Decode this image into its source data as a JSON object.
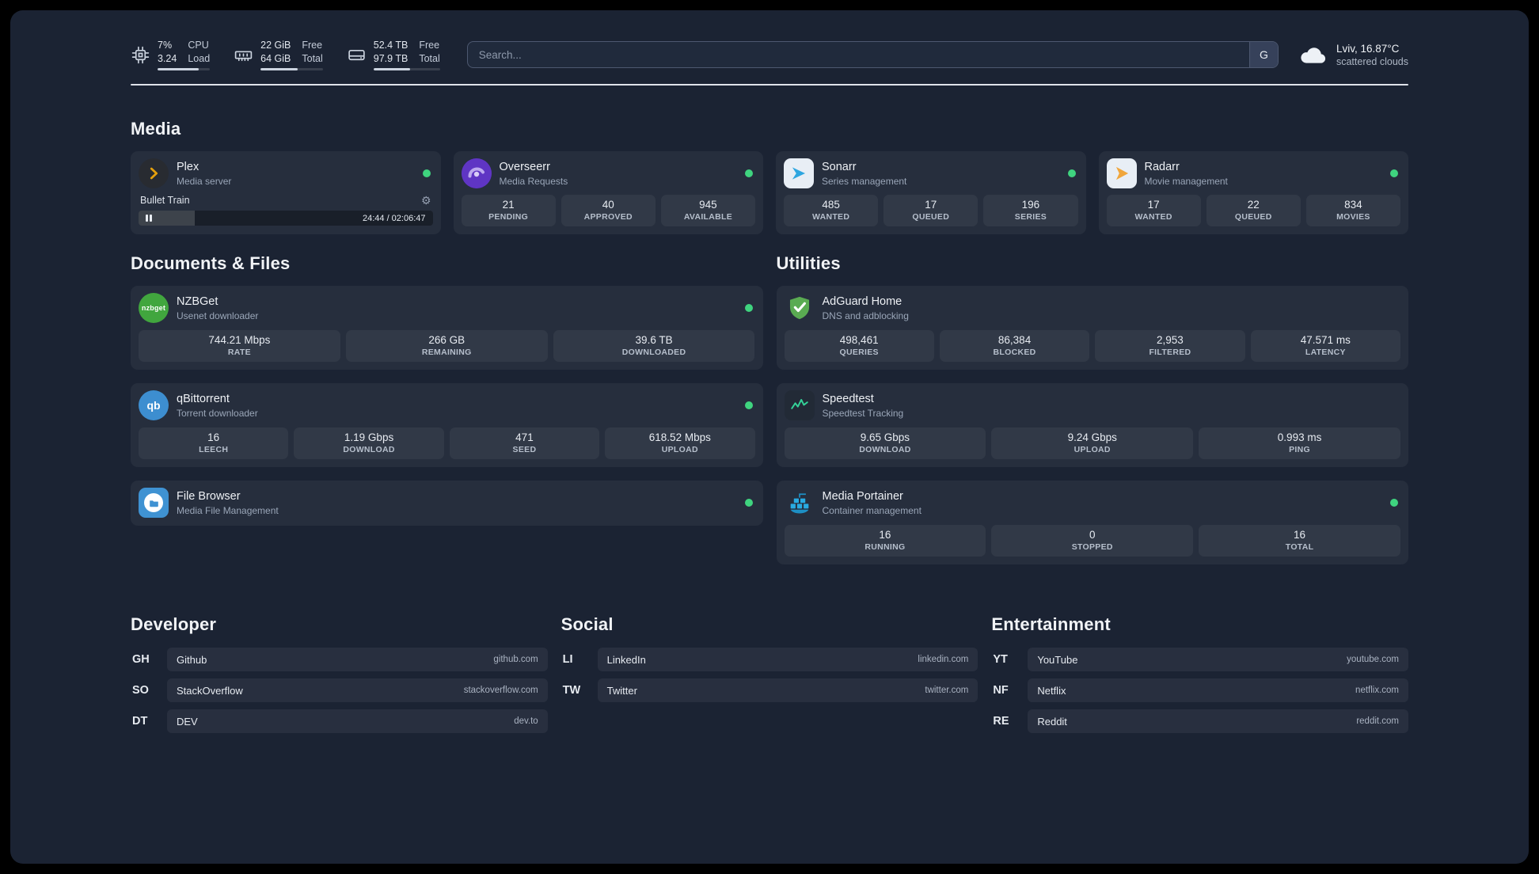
{
  "topbar": {
    "cpu": {
      "value1": "7%",
      "value2": "3.24",
      "label1": "CPU",
      "label2": "Load"
    },
    "memory": {
      "value1": "22 GiB",
      "value2": "64 GiB",
      "label1": "Free",
      "label2": "Total"
    },
    "disk": {
      "value1": "52.4 TB",
      "value2": "97.9 TB",
      "label1": "Free",
      "label2": "Total"
    },
    "search": {
      "placeholder": "Search...",
      "provider_label": "G"
    },
    "weather": {
      "location": "Lviv, 16.87°C",
      "condition": "scattered clouds"
    }
  },
  "sections": {
    "media": "Media",
    "documents": "Documents & Files",
    "utilities": "Utilities",
    "developer": "Developer",
    "social": "Social",
    "entertainment": "Entertainment"
  },
  "services": {
    "plex": {
      "title": "Plex",
      "subtitle": "Media server",
      "now_playing": "Bullet Train",
      "time": "24:44 / 02:06:47"
    },
    "overseerr": {
      "title": "Overseerr",
      "subtitle": "Media Requests",
      "stats": [
        {
          "value": "21",
          "label": "PENDING"
        },
        {
          "value": "40",
          "label": "APPROVED"
        },
        {
          "value": "945",
          "label": "AVAILABLE"
        }
      ]
    },
    "sonarr": {
      "title": "Sonarr",
      "subtitle": "Series management",
      "stats": [
        {
          "value": "485",
          "label": "WANTED"
        },
        {
          "value": "17",
          "label": "QUEUED"
        },
        {
          "value": "196",
          "label": "SERIES"
        }
      ]
    },
    "radarr": {
      "title": "Radarr",
      "subtitle": "Movie management",
      "stats": [
        {
          "value": "17",
          "label": "WANTED"
        },
        {
          "value": "22",
          "label": "QUEUED"
        },
        {
          "value": "834",
          "label": "MOVIES"
        }
      ]
    },
    "nzbget": {
      "title": "NZBGet",
      "subtitle": "Usenet downloader",
      "logo_text": "nzbget",
      "stats": [
        {
          "value": "744.21 Mbps",
          "label": "RATE"
        },
        {
          "value": "266 GB",
          "label": "REMAINING"
        },
        {
          "value": "39.6 TB",
          "label": "DOWNLOADED"
        }
      ]
    },
    "qbittorrent": {
      "title": "qBittorrent",
      "subtitle": "Torrent downloader",
      "logo_text": "qb",
      "stats": [
        {
          "value": "16",
          "label": "LEECH"
        },
        {
          "value": "1.19 Gbps",
          "label": "DOWNLOAD"
        },
        {
          "value": "471",
          "label": "SEED"
        },
        {
          "value": "618.52 Mbps",
          "label": "UPLOAD"
        }
      ]
    },
    "filebrowser": {
      "title": "File Browser",
      "subtitle": "Media File Management"
    },
    "adguard": {
      "title": "AdGuard Home",
      "subtitle": "DNS and adblocking",
      "stats": [
        {
          "value": "498,461",
          "label": "QUERIES"
        },
        {
          "value": "86,384",
          "label": "BLOCKED"
        },
        {
          "value": "2,953",
          "label": "FILTERED"
        },
        {
          "value": "47.571 ms",
          "label": "LATENCY"
        }
      ]
    },
    "speedtest": {
      "title": "Speedtest",
      "subtitle": "Speedtest Tracking",
      "stats": [
        {
          "value": "9.65 Gbps",
          "label": "DOWNLOAD"
        },
        {
          "value": "9.24 Gbps",
          "label": "UPLOAD"
        },
        {
          "value": "0.993 ms",
          "label": "PING"
        }
      ]
    },
    "portainer": {
      "title": "Media Portainer",
      "subtitle": "Container management",
      "stats": [
        {
          "value": "16",
          "label": "RUNNING"
        },
        {
          "value": "0",
          "label": "STOPPED"
        },
        {
          "value": "16",
          "label": "TOTAL"
        }
      ]
    }
  },
  "bookmarks": {
    "developer": [
      {
        "abbr": "GH",
        "name": "Github",
        "url": "github.com"
      },
      {
        "abbr": "SO",
        "name": "StackOverflow",
        "url": "stackoverflow.com"
      },
      {
        "abbr": "DT",
        "name": "DEV",
        "url": "dev.to"
      }
    ],
    "social": [
      {
        "abbr": "LI",
        "name": "LinkedIn",
        "url": "linkedin.com"
      },
      {
        "abbr": "TW",
        "name": "Twitter",
        "url": "twitter.com"
      }
    ],
    "entertainment": [
      {
        "abbr": "YT",
        "name": "YouTube",
        "url": "youtube.com"
      },
      {
        "abbr": "NF",
        "name": "Netflix",
        "url": "netflix.com"
      },
      {
        "abbr": "RE",
        "name": "Reddit",
        "url": "reddit.com"
      }
    ]
  },
  "colors": {
    "status_online": "#3fd47f",
    "accent_plex": "#e5a00d",
    "accent_overseerr": "#5f35c4",
    "accent_sonarr": "#2ea6e0",
    "accent_radarr": "#f0a63c",
    "accent_nzbget": "#41a63e",
    "accent_qbittorrent": "#3d8ed0",
    "accent_filebrowser": "#3f92d2",
    "accent_adguard": "#5aab52",
    "accent_speedtest": "#34d399",
    "accent_portainer": "#29abe2"
  }
}
